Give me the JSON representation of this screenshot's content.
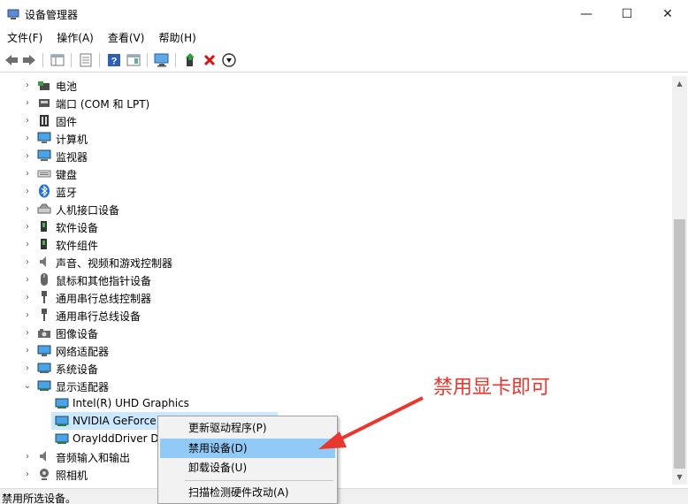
{
  "window": {
    "title": "设备管理器",
    "minimize": "—",
    "maximize": "☐",
    "close": "✕"
  },
  "menu": {
    "items": [
      "文件(F)",
      "操作(A)",
      "查看(V)",
      "帮助(H)"
    ]
  },
  "tree": {
    "categories": [
      {
        "label": "电池",
        "icon": "battery-icon"
      },
      {
        "label": "端口 (COM 和 LPT)",
        "icon": "port-icon"
      },
      {
        "label": "固件",
        "icon": "firmware-icon"
      },
      {
        "label": "计算机",
        "icon": "computer-icon"
      },
      {
        "label": "监视器",
        "icon": "monitor-icon"
      },
      {
        "label": "键盘",
        "icon": "keyboard-icon"
      },
      {
        "label": "蓝牙",
        "icon": "bluetooth-icon"
      },
      {
        "label": "人机接口设备",
        "icon": "hid-icon"
      },
      {
        "label": "软件设备",
        "icon": "software-device-icon"
      },
      {
        "label": "软件组件",
        "icon": "software-component-icon"
      },
      {
        "label": "声音、视频和游戏控制器",
        "icon": "speaker-icon"
      },
      {
        "label": "鼠标和其他指针设备",
        "icon": "mouse-icon"
      },
      {
        "label": "通用串行总线控制器",
        "icon": "usb-icon"
      },
      {
        "label": "通用串行总线设备",
        "icon": "usb-icon"
      },
      {
        "label": "图像设备",
        "icon": "camera-icon"
      },
      {
        "label": "网络适配器",
        "icon": "network-icon"
      },
      {
        "label": "系统设备",
        "icon": "system-icon"
      },
      {
        "label": "显示适配器",
        "icon": "display-adapter-icon"
      }
    ],
    "display_children": [
      {
        "label": "Intel(R) UHD Graphics"
      },
      {
        "label": "NVIDIA GeForce"
      },
      {
        "label": "OrayIddDriver D"
      }
    ],
    "after": [
      {
        "label": "音频输入和输出",
        "icon": "speaker-icon"
      },
      {
        "label": "照相机",
        "icon": "webcam-icon"
      }
    ]
  },
  "context_menu": {
    "items": [
      "更新驱动程序(P)",
      "禁用设备(D)",
      "卸载设备(U)",
      "扫描检测硬件改动(A)"
    ],
    "highlighted_index": 1
  },
  "annotation": {
    "text": "禁用显卡即可",
    "color": "#e8372e"
  },
  "status": {
    "text": "禁用所选设备。"
  }
}
